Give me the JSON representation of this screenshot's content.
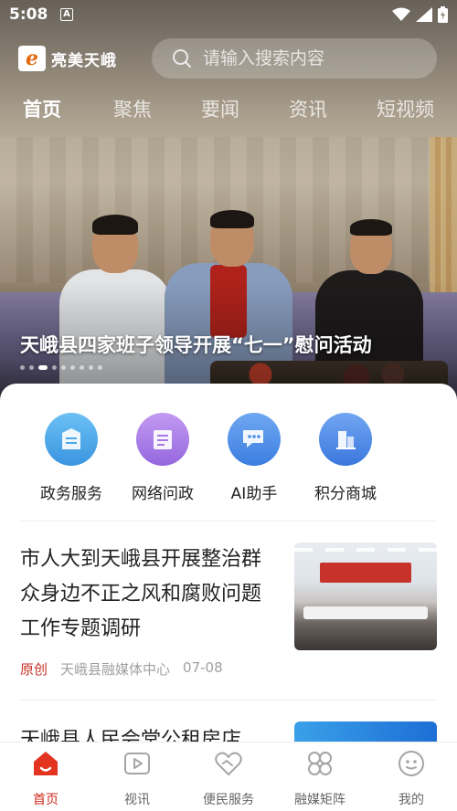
{
  "status_bar": {
    "time": "5:08",
    "badge": "A"
  },
  "header": {
    "logo_mark": "e",
    "logo_text": "亮美天峨",
    "search_placeholder": "请输入搜索内容"
  },
  "tabs": [
    {
      "label": "首页",
      "active": true
    },
    {
      "label": "聚焦",
      "active": false
    },
    {
      "label": "要闻",
      "active": false
    },
    {
      "label": "资讯",
      "active": false
    },
    {
      "label": "短视频",
      "active": false
    }
  ],
  "hero": {
    "title": "天峨县四家班子领导开展“七一”慰问活动",
    "slide_count": 9,
    "active_slide": 2
  },
  "services": [
    {
      "label": "政务服务",
      "icon": "gov-service-icon",
      "color": "#4aa7ea"
    },
    {
      "label": "网络问政",
      "icon": "online-inquiry-icon",
      "color": "#a57ae6"
    },
    {
      "label": "AI助手",
      "icon": "ai-assistant-icon",
      "color": "#4b8ee9"
    },
    {
      "label": "积分商城",
      "icon": "points-mall-icon",
      "color": "#4d88e8"
    }
  ],
  "news": [
    {
      "title": "市人大到天峨县开展整治群众身边不正之风和腐败问题工作专题调研",
      "tag": "原创",
      "source": "天峨县融媒体中心",
      "date": "07-08"
    },
    {
      "title": "天峨县人民会堂公租房店"
    }
  ],
  "bottom_nav": [
    {
      "label": "首页",
      "icon": "home-icon",
      "active": true
    },
    {
      "label": "视讯",
      "icon": "video-icon",
      "active": false
    },
    {
      "label": "便民服务",
      "icon": "heart-service-icon",
      "active": false
    },
    {
      "label": "融媒矩阵",
      "icon": "matrix-icon",
      "active": false
    },
    {
      "label": "我的",
      "icon": "profile-icon",
      "active": false
    }
  ],
  "colors": {
    "accent": "#d0281c",
    "tag_red": "#c8332a",
    "meta_gray": "#a0a0a0"
  }
}
